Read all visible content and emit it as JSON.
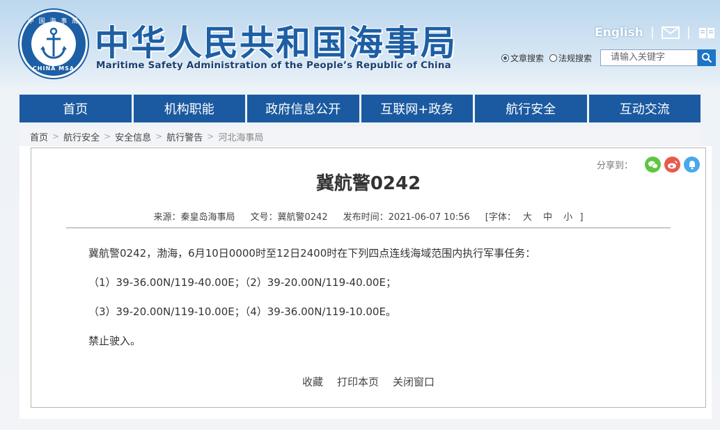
{
  "header": {
    "logo_top_text": "中 国 海 事 局",
    "logo_bottom_text": "CHINA MSA",
    "title": "中华人民共和国海事局",
    "subtitle": "Maritime Safety Administration of the People’s Republic of China",
    "english_link": "English",
    "separator": "|"
  },
  "search": {
    "options": [
      {
        "label": "文章搜索",
        "checked": true
      },
      {
        "label": "法规搜索",
        "checked": false
      }
    ],
    "placeholder": "请输入关键字"
  },
  "nav": {
    "items": [
      "首页",
      "机构职能",
      "政府信息公开",
      "互联网+政务",
      "航行安全",
      "互动交流"
    ]
  },
  "breadcrumb": {
    "items": [
      "首页",
      "航行安全",
      "安全信息",
      "航行警告",
      "河北海事局"
    ],
    "separator": ">"
  },
  "article": {
    "share_label": "分享到：",
    "title": "冀航警0242",
    "source": "来源：秦皇岛海事局",
    "doc_no": "文号：冀航警0242",
    "publish_time": "发布时间：2021-06-07 10:56",
    "font_label": "[字体：",
    "font_sizes": [
      "大",
      "中",
      "小"
    ],
    "font_close": "]",
    "paragraphs": [
      "冀航警0242，渤海，6月10日0000时至12日2400时在下列四点连线海域范围内执行军事任务：",
      "（1）39-36.00N/119-40.00E；（2）39-20.00N/119-40.00E；",
      "（3）39-20.00N/119-10.00E；（4）39-36.00N/119-10.00E。",
      "禁止驶入。"
    ],
    "actions": [
      "收藏",
      "打印本页",
      "关闭窗口"
    ]
  },
  "colors": {
    "brand_blue": "#1d5fa5",
    "nav_blue": "#1b5aa0",
    "wechat_green": "#5ec640",
    "weibo_red": "#e85a4f",
    "qq_blue": "#4aa8ec"
  }
}
